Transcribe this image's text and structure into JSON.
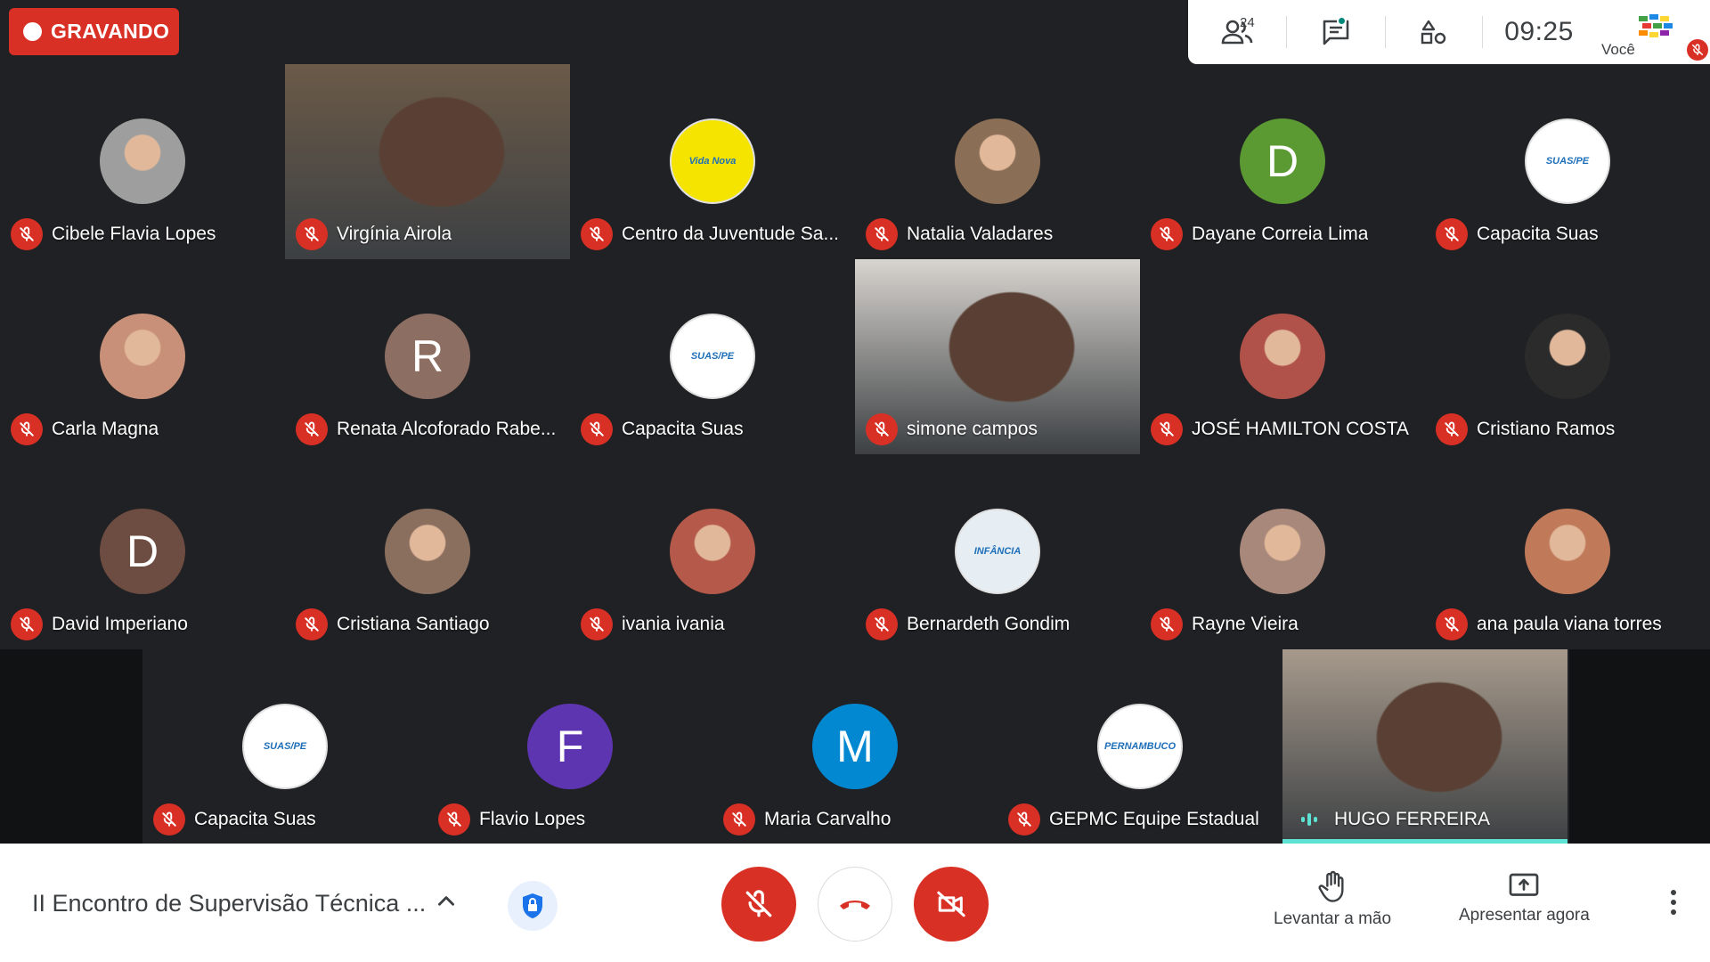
{
  "recording": {
    "label": "GRAVANDO"
  },
  "topbar": {
    "participants_count": "24",
    "clock": "09:25",
    "self_label": "Você"
  },
  "participants": [
    {
      "name": "Cibele Flavia Lopes",
      "kind": "photo",
      "color": "#9e9e9e"
    },
    {
      "name": "Virgínia Airola",
      "kind": "video",
      "color": "#6b5a48"
    },
    {
      "name": "Centro da Juventude Sa...",
      "kind": "logo",
      "color": "#f5e400",
      "logo_text": "Vida Nova"
    },
    {
      "name": "Natalia Valadares",
      "kind": "photo",
      "color": "#8a6e55"
    },
    {
      "name": "Dayane Correia Lima",
      "kind": "letter",
      "letter": "D",
      "color": "#5b9a32"
    },
    {
      "name": "Capacita Suas",
      "kind": "logo",
      "color": "#ffffff",
      "logo_text": "SUAS/PE"
    },
    {
      "name": "Carla Magna",
      "kind": "photo",
      "color": "#c89078"
    },
    {
      "name": "Renata Alcoforado Rabe...",
      "kind": "letter",
      "letter": "R",
      "color": "#8d6e63"
    },
    {
      "name": "Capacita Suas",
      "kind": "logo",
      "color": "#ffffff",
      "logo_text": "SUAS/PE"
    },
    {
      "name": "simone campos",
      "kind": "video",
      "color": "#d8d4cf"
    },
    {
      "name": "JOSÉ HAMILTON COSTA",
      "kind": "photo",
      "color": "#b0524a"
    },
    {
      "name": "Cristiano Ramos",
      "kind": "photo",
      "color": "#2b2b2b"
    },
    {
      "name": "David Imperiano",
      "kind": "letter",
      "letter": "D",
      "color": "#6d4c41"
    },
    {
      "name": "Cristiana Santiago",
      "kind": "photo",
      "color": "#8a6f5f"
    },
    {
      "name": "ivania ivania",
      "kind": "photo",
      "color": "#b55a4a"
    },
    {
      "name": "Bernardeth Gondim",
      "kind": "logo",
      "color": "#e6eef4",
      "logo_text": "INFÂNCIA"
    },
    {
      "name": "Rayne Vieira",
      "kind": "photo",
      "color": "#a8887a"
    },
    {
      "name": "ana paula viana torres",
      "kind": "photo",
      "color": "#c07a5a"
    },
    {
      "name": "Capacita Suas",
      "kind": "logo",
      "color": "#ffffff",
      "logo_text": "SUAS/PE"
    },
    {
      "name": "Flavio Lopes",
      "kind": "letter",
      "letter": "F",
      "color": "#5e35b1"
    },
    {
      "name": "Maria Carvalho",
      "kind": "letter",
      "letter": "M",
      "color": "#0288d1"
    },
    {
      "name": "GEPMC Equipe Estadual",
      "kind": "logo",
      "color": "#ffffff",
      "logo_text": "PERNAMBUCO"
    },
    {
      "name": "HUGO FERREIRA",
      "kind": "video",
      "color": "#a79a8c",
      "speaking": true
    }
  ],
  "bottom": {
    "meeting_title": "II Encontro de Supervisão Técnica ...",
    "raise_hand_label": "Levantar a mão",
    "present_label": "Apresentar agora"
  },
  "colors": {
    "danger": "#d93025",
    "background": "#202124",
    "speaking": "#5de2d4"
  }
}
